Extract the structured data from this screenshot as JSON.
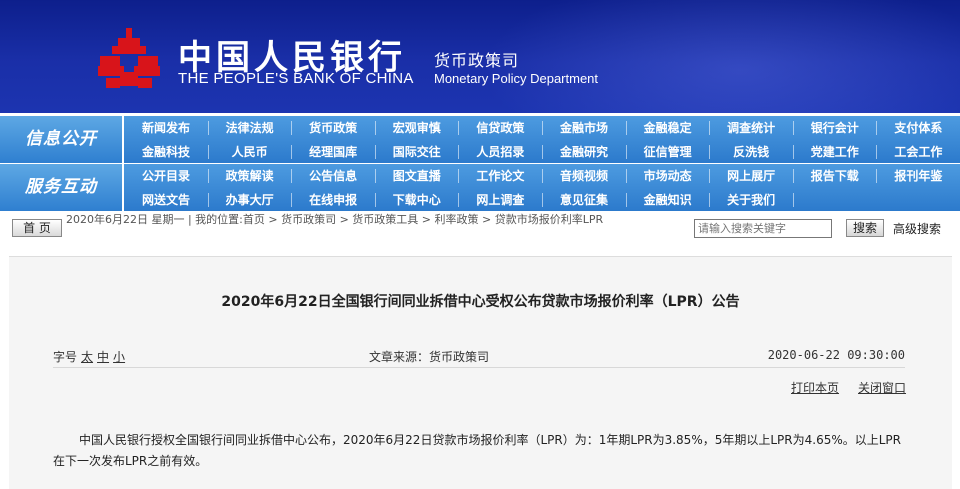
{
  "header": {
    "bank_name_cn": "中国人民银行",
    "bank_name_en": "THE PEOPLE'S BANK OF CHINA",
    "department_cn": "货币政策司",
    "department_en": "Monetary Policy Department",
    "logo_icon": "pboc-logo-icon",
    "colors": {
      "background": "#1a2fa8",
      "logo": "#d8141a"
    }
  },
  "nav": {
    "group1": {
      "label": "信息公开",
      "row1": [
        "新闻发布",
        "法律法规",
        "货币政策",
        "宏观审慎",
        "信贷政策",
        "金融市场",
        "金融稳定",
        "调查统计",
        "银行会计",
        "支付体系"
      ],
      "row2": [
        "金融科技",
        "人民币",
        "经理国库",
        "国际交往",
        "人员招录",
        "金融研究",
        "征信管理",
        "反洗钱",
        "党建工作",
        "工会工作"
      ]
    },
    "group2": {
      "label": "服务互动",
      "row1": [
        "公开目录",
        "政策解读",
        "公告信息",
        "图文直播",
        "工作论文",
        "音频视频",
        "市场动态",
        "网上展厅",
        "报告下载",
        "报刊年鉴"
      ],
      "row2": [
        "网送文告",
        "办事大厅",
        "在线申报",
        "下载中心",
        "网上调查",
        "意见征集",
        "金融知识",
        "关于我们"
      ]
    },
    "colors": {
      "bar": "#2f7fd0"
    }
  },
  "toolbar": {
    "home_label": "首 页",
    "breadcrumb": "2020年6月22日 星期一 | 我的位置:首页 > 货币政策司 > 货币政策工具 > 利率政策 > 贷款市场报价利率LPR",
    "search_placeholder": "请输入搜索关键字",
    "search_button": "搜索",
    "advanced_search": "高级搜索"
  },
  "article": {
    "title": "2020年6月22日全国银行间同业拆借中心受权公布贷款市场报价利率（LPR）公告",
    "font_size_label": "字号",
    "font_sizes": [
      "太",
      "中",
      "小"
    ],
    "source": "文章来源：货币政策司",
    "datetime": "2020-06-22  09:30:00",
    "print_label": "打印本页",
    "close_label": "关闭窗口",
    "body": "中国人民银行授权全国银行间同业拆借中心公布，2020年6月22日贷款市场报价利率（LPR）为：1年期LPR为3.85%，5年期以上LPR为4.65%。以上LPR在下一次发布LPR之前有效。"
  }
}
